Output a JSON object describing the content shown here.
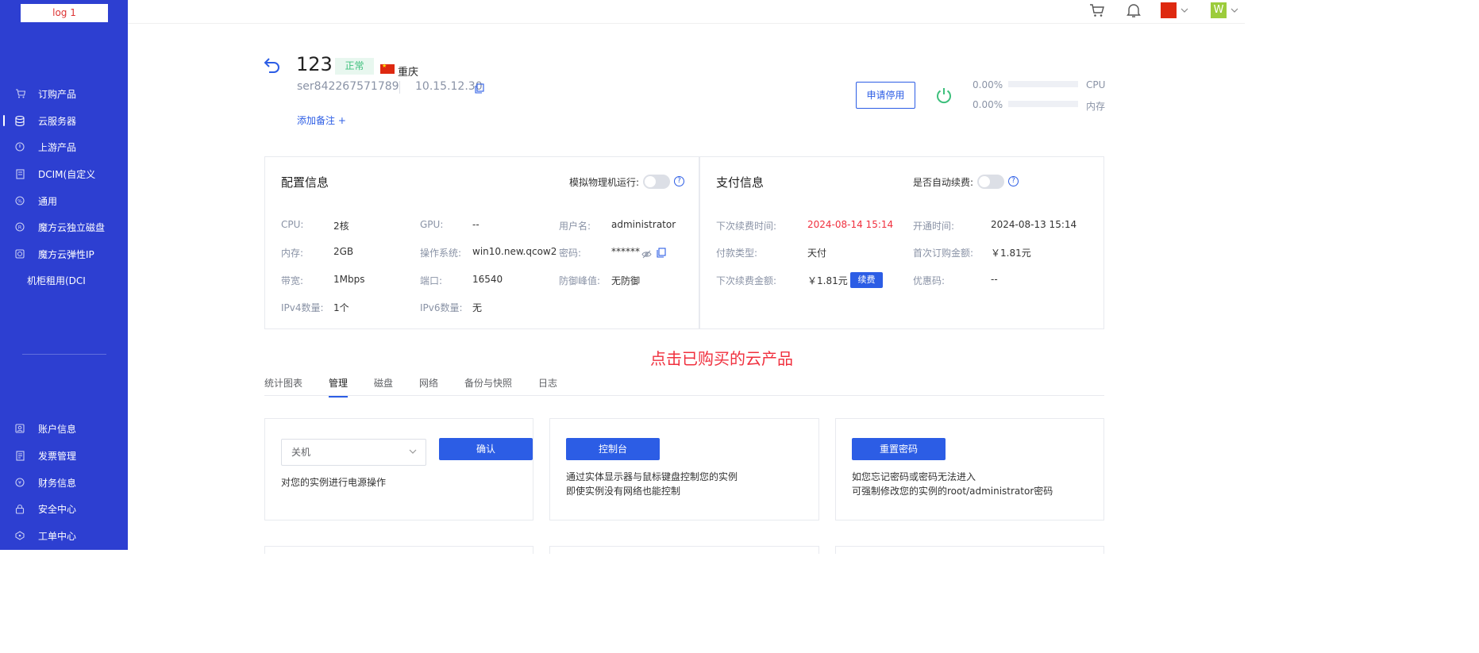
{
  "sidebar": {
    "logo": "log 1",
    "items": [
      {
        "label": "订购产品"
      },
      {
        "label": "云服务器"
      },
      {
        "label": "上游产品"
      },
      {
        "label": "DCIM(自定义"
      },
      {
        "label": "通用"
      },
      {
        "label": "魔方云独立磁盘"
      },
      {
        "label": "魔方云弹性IP"
      },
      {
        "label": "机柜租用(DCI"
      }
    ],
    "bottom_items": [
      {
        "label": "账户信息"
      },
      {
        "label": "发票管理"
      },
      {
        "label": "财务信息"
      },
      {
        "label": "安全中心"
      },
      {
        "label": "工单中心"
      }
    ]
  },
  "topbar": {
    "avatar_letter": "W"
  },
  "server": {
    "name": "123",
    "status": "正常",
    "region": "重庆",
    "id": "ser842267571789",
    "ip": "10.15.12.30",
    "add_note": "添加备注 +",
    "stop_button": "申请停用",
    "cpu_pct": "0.00%",
    "cpu_label": "CPU",
    "cpu_usage": 0,
    "mem_pct": "0.00%",
    "mem_label": "内存",
    "mem_usage": 0
  },
  "config": {
    "title": "配置信息",
    "switch_label": "模拟物理机运行:",
    "cpu_label": "CPU:",
    "cpu": "2核",
    "gpu_label": "GPU:",
    "gpu": "--",
    "user_label": "用户名:",
    "user": "administrator",
    "mem_label": "内存:",
    "mem": "2GB",
    "os_label": "操作系统:",
    "os": "win10.new.qcow2",
    "pwd_label": "密码:",
    "pwd": "******",
    "bw_label": "带宽:",
    "bw": "1Mbps",
    "port_label": "端口:",
    "port": "16540",
    "ddos_label": "防御峰值:",
    "ddos": "无防御",
    "ipv4_label": "IPv4数量:",
    "ipv4": "1个",
    "ipv6_label": "IPv6数量:",
    "ipv6": "无"
  },
  "payment": {
    "title": "支付信息",
    "switch_label": "是否自动续费:",
    "next_renew_label": "下次续费时间:",
    "next_renew": "2024-08-14 15:14",
    "open_label": "开通时间:",
    "open": "2024-08-13 15:14",
    "pay_type_label": "付款类型:",
    "pay_type": "天付",
    "first_amount_label": "首次订购金额:",
    "first_amount": "￥1.81元",
    "next_amount_label": "下次续费金额:",
    "next_amount": "￥1.81元",
    "renew_button": "续费",
    "coupon_label": "优惠码:",
    "coupon": "--"
  },
  "annotation": "点击已购买的云产品",
  "tabs": [
    "统计图表",
    "管理",
    "磁盘",
    "网络",
    "备份与快照",
    "日志"
  ],
  "manage": {
    "power": {
      "select_value": "关机",
      "confirm": "确认",
      "desc": "对您的实例进行电源操作"
    },
    "console": {
      "button": "控制台",
      "desc1": "通过实体显示器与鼠标键盘控制您的实例",
      "desc2": "即使实例没有网络也能控制"
    },
    "reset": {
      "button": "重置密码",
      "desc1": "如您忘记密码或密码无法进入",
      "desc2": "可强制修改您的实例的root/administrator密码"
    }
  },
  "colors": {
    "sidebar_bg": "#2d3fd1",
    "primary": "#2c5de5",
    "danger": "#f0303e",
    "success": "#3fc07d"
  }
}
